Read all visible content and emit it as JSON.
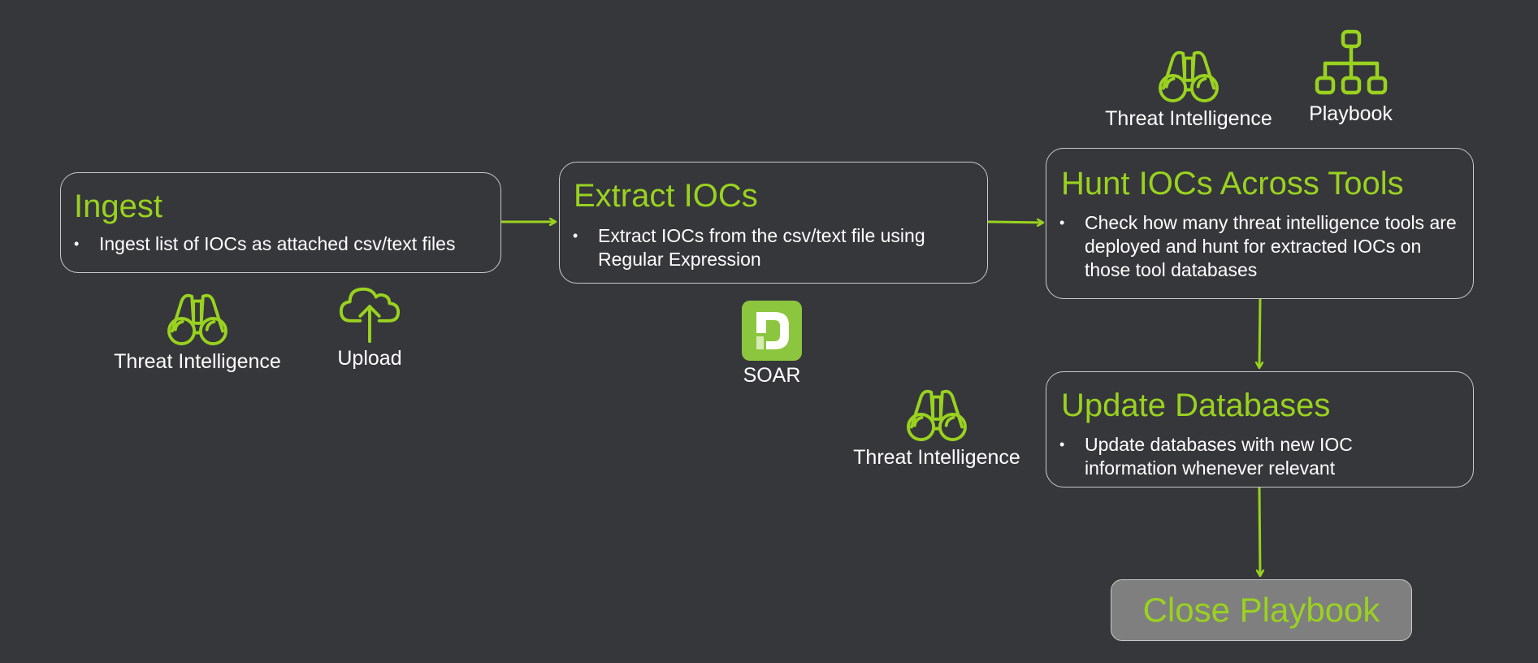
{
  "colors": {
    "background": "#36373b",
    "accent": "#99d21f",
    "box_border": "#c9c9c9",
    "text": "#ffffff",
    "close_fill": "#7f7f7f"
  },
  "steps": [
    {
      "title": "Ingest",
      "bullets": [
        "Ingest list of IOCs as attached csv/text files"
      ],
      "tools": [
        {
          "icon": "binoculars-icon",
          "label": "Threat Intelligence"
        },
        {
          "icon": "cloud-upload-icon",
          "label": "Upload"
        }
      ]
    },
    {
      "title": "Extract IOCs",
      "bullets": [
        "Extract IOCs from the csv/text file using Regular Expression"
      ],
      "tools": [
        {
          "icon": "soar-logo-icon",
          "label": "SOAR"
        }
      ]
    },
    {
      "title": "Hunt IOCs Across Tools",
      "bullets": [
        "Check how many threat intelligence tools are deployed and hunt for extracted IOCs on those tool databases"
      ],
      "tools": [
        {
          "icon": "binoculars-icon",
          "label": "Threat Intelligence"
        },
        {
          "icon": "playbook-hierarchy-icon",
          "label": "Playbook"
        }
      ]
    },
    {
      "title": "Update Databases",
      "bullets": [
        "Update databases with new IOC information whenever relevant"
      ],
      "tools": [
        {
          "icon": "binoculars-icon",
          "label": "Threat Intelligence"
        }
      ]
    }
  ],
  "end": {
    "label": "Close Playbook"
  },
  "flow": [
    {
      "from": "Ingest",
      "to": "Extract IOCs"
    },
    {
      "from": "Extract IOCs",
      "to": "Hunt IOCs Across Tools"
    },
    {
      "from": "Hunt IOCs Across Tools",
      "to": "Update Databases"
    },
    {
      "from": "Update Databases",
      "to": "Close Playbook"
    }
  ]
}
